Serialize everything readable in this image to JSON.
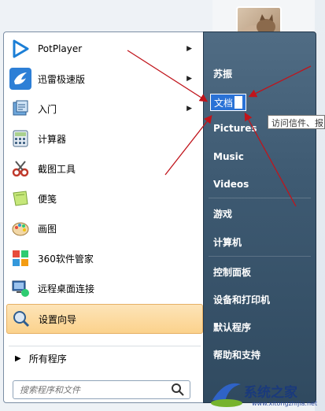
{
  "programs": [
    {
      "label": "PotPlayer",
      "icon": "potplayer-icon",
      "has_submenu": true
    },
    {
      "label": "迅雷极速版",
      "icon": "xunlei-bird-icon",
      "has_submenu": true
    },
    {
      "label": "入门",
      "icon": "getting-started-icon",
      "has_submenu": true
    },
    {
      "label": "计算器",
      "icon": "calculator-icon",
      "has_submenu": false
    },
    {
      "label": "截图工具",
      "icon": "scissors-icon",
      "has_submenu": false
    },
    {
      "label": "便笺",
      "icon": "sticky-notes-icon",
      "has_submenu": false
    },
    {
      "label": "画图",
      "icon": "paint-palette-icon",
      "has_submenu": false
    },
    {
      "label": "360软件管家",
      "icon": "360-manager-icon",
      "has_submenu": false
    },
    {
      "label": "远程桌面连接",
      "icon": "remote-desktop-icon",
      "has_submenu": false
    },
    {
      "label": "设置向导",
      "icon": "setup-wizard-icon",
      "has_submenu": false
    }
  ],
  "all_programs_label": "所有程序",
  "search": {
    "placeholder": "搜索程序和文件"
  },
  "right_items": [
    {
      "label": "苏振"
    },
    {
      "label": "文档"
    },
    {
      "label": "Pictures"
    },
    {
      "label": "Music"
    },
    {
      "label": "Videos"
    },
    {
      "label": "游戏"
    },
    {
      "label": "计算机"
    },
    {
      "label": "控制面板"
    },
    {
      "label": "设备和打印机"
    },
    {
      "label": "默认程序"
    },
    {
      "label": "帮助和支持"
    }
  ],
  "tooltip": "访问信件、报",
  "watermark": {
    "brand": "系统之家",
    "url": "www.xitongzhijia.net"
  },
  "colors": {
    "right_pane": "#3e5a72",
    "selected_item": "#fbd28c",
    "rename_highlight": "#2a72d6",
    "annotation_arrow": "#c0141b"
  }
}
